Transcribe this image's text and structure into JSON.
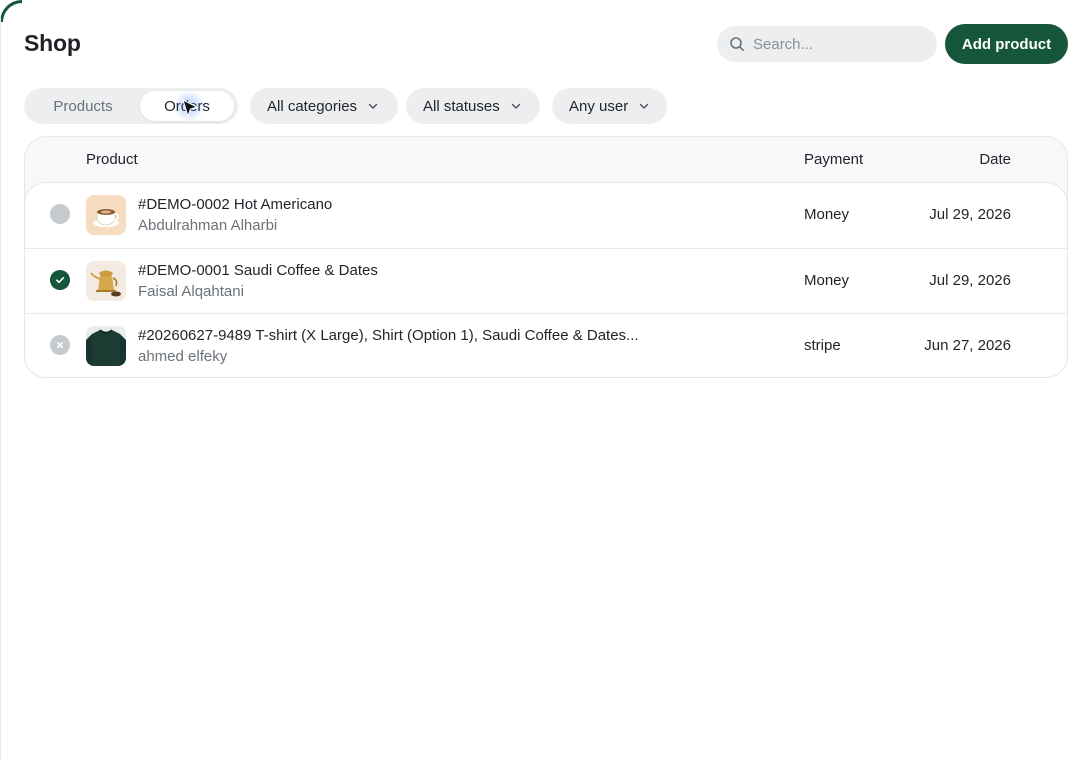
{
  "header": {
    "title": "Shop",
    "search_placeholder": "Search...",
    "add_button_label": "Add product"
  },
  "tabs": [
    {
      "label": "Products",
      "active": false
    },
    {
      "label": "Orders",
      "active": true
    }
  ],
  "filters": {
    "category": "All categories",
    "status": "All statuses",
    "user": "Any user"
  },
  "table": {
    "columns": {
      "product": "Product",
      "payment": "Payment",
      "date": "Date"
    },
    "rows": [
      {
        "status": "pending",
        "thumbnail": "coffee-cup-icon",
        "title": "#DEMO-0002 Hot Americano",
        "customer": "Abdulrahman Alharbi",
        "payment": "Money",
        "date": "Jul 29, 2026"
      },
      {
        "status": "completed",
        "thumbnail": "dallah-coffee-pot-icon",
        "title": "#DEMO-0001 Saudi Coffee & Dates",
        "customer": "Faisal Alqahtani",
        "payment": "Money",
        "date": "Jul 29, 2026"
      },
      {
        "status": "cancelled",
        "thumbnail": "tshirt-icon",
        "title": "#20260627-9489 T-shirt (X Large), Shirt (Option 1), Saudi Coffee & Dates...",
        "customer": "ahmed elfeky",
        "payment": "stripe",
        "date": "Jun 27, 2026"
      }
    ]
  },
  "colors": {
    "accent": "#16563a",
    "pill_background": "#eceef0",
    "status_neutral": "#c4cacd"
  }
}
